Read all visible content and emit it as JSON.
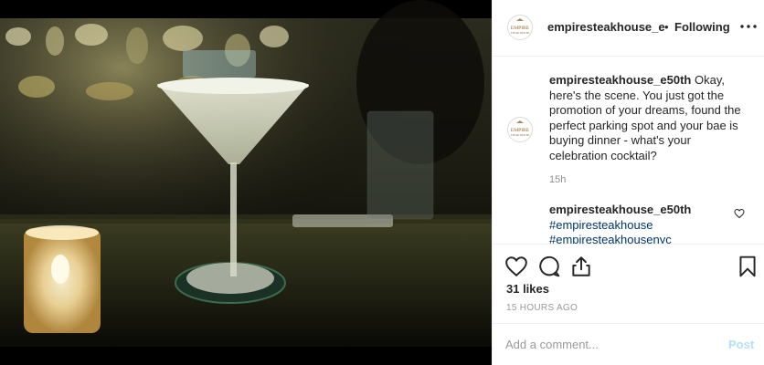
{
  "post": {
    "username": "empiresteakhouse_e",
    "separator": "•",
    "follow_state": "Following",
    "avatar_logo_text": [
      "EMPIRE",
      "STEAK HOUSE"
    ]
  },
  "caption": {
    "username": "empiresteakhouse_e50th",
    "text": "Okay, here's the scene. You just got the promotion of your dreams, found the perfect parking spot and your bae is buying dinner - what's your celebration cocktail?",
    "time": "15h"
  },
  "comment": {
    "username": "empiresteakhouse_e50th",
    "hashtags": [
      "#empiresteakhouse",
      "#empiresteakhousenyc"
    ]
  },
  "engagement": {
    "likes": "31 likes",
    "time_ago": "15 HOURS AGO"
  },
  "add_comment": {
    "placeholder": "Add a comment...",
    "post_label": "Post"
  },
  "colors": {
    "link": "#003569",
    "post_disabled": "#b2dffc",
    "muted": "#8e8e8e",
    "divider": "#efefef"
  }
}
